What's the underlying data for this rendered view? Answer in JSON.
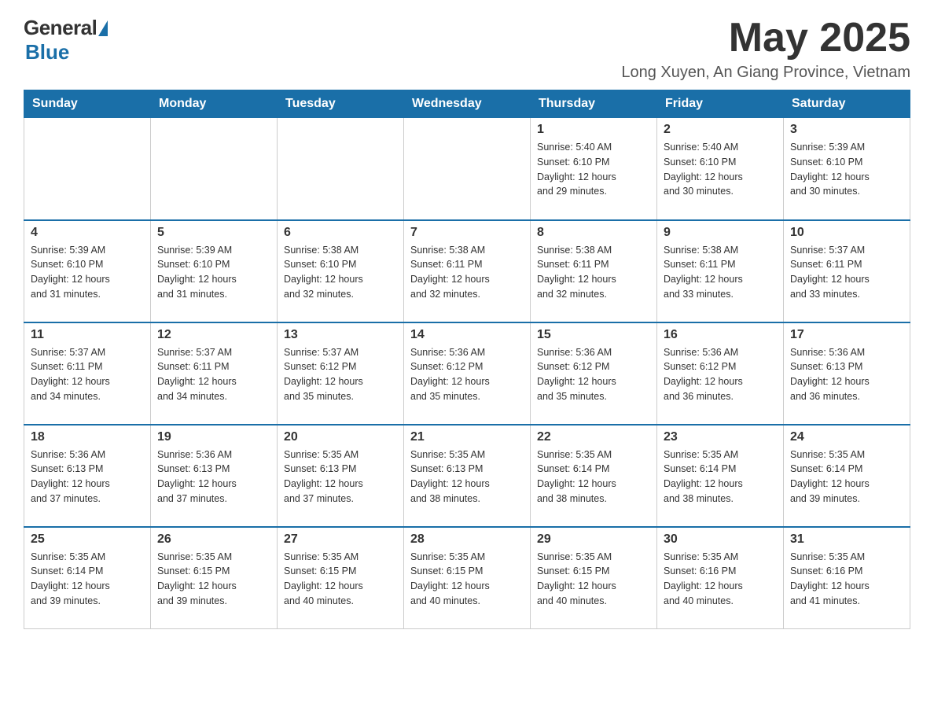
{
  "header": {
    "logo_general": "General",
    "logo_blue": "Blue",
    "month_title": "May 2025",
    "location": "Long Xuyen, An Giang Province, Vietnam"
  },
  "days_of_week": [
    "Sunday",
    "Monday",
    "Tuesday",
    "Wednesday",
    "Thursday",
    "Friday",
    "Saturday"
  ],
  "weeks": [
    [
      {
        "day": "",
        "info": ""
      },
      {
        "day": "",
        "info": ""
      },
      {
        "day": "",
        "info": ""
      },
      {
        "day": "",
        "info": ""
      },
      {
        "day": "1",
        "info": "Sunrise: 5:40 AM\nSunset: 6:10 PM\nDaylight: 12 hours\nand 29 minutes."
      },
      {
        "day": "2",
        "info": "Sunrise: 5:40 AM\nSunset: 6:10 PM\nDaylight: 12 hours\nand 30 minutes."
      },
      {
        "day": "3",
        "info": "Sunrise: 5:39 AM\nSunset: 6:10 PM\nDaylight: 12 hours\nand 30 minutes."
      }
    ],
    [
      {
        "day": "4",
        "info": "Sunrise: 5:39 AM\nSunset: 6:10 PM\nDaylight: 12 hours\nand 31 minutes."
      },
      {
        "day": "5",
        "info": "Sunrise: 5:39 AM\nSunset: 6:10 PM\nDaylight: 12 hours\nand 31 minutes."
      },
      {
        "day": "6",
        "info": "Sunrise: 5:38 AM\nSunset: 6:10 PM\nDaylight: 12 hours\nand 32 minutes."
      },
      {
        "day": "7",
        "info": "Sunrise: 5:38 AM\nSunset: 6:11 PM\nDaylight: 12 hours\nand 32 minutes."
      },
      {
        "day": "8",
        "info": "Sunrise: 5:38 AM\nSunset: 6:11 PM\nDaylight: 12 hours\nand 32 minutes."
      },
      {
        "day": "9",
        "info": "Sunrise: 5:38 AM\nSunset: 6:11 PM\nDaylight: 12 hours\nand 33 minutes."
      },
      {
        "day": "10",
        "info": "Sunrise: 5:37 AM\nSunset: 6:11 PM\nDaylight: 12 hours\nand 33 minutes."
      }
    ],
    [
      {
        "day": "11",
        "info": "Sunrise: 5:37 AM\nSunset: 6:11 PM\nDaylight: 12 hours\nand 34 minutes."
      },
      {
        "day": "12",
        "info": "Sunrise: 5:37 AM\nSunset: 6:11 PM\nDaylight: 12 hours\nand 34 minutes."
      },
      {
        "day": "13",
        "info": "Sunrise: 5:37 AM\nSunset: 6:12 PM\nDaylight: 12 hours\nand 35 minutes."
      },
      {
        "day": "14",
        "info": "Sunrise: 5:36 AM\nSunset: 6:12 PM\nDaylight: 12 hours\nand 35 minutes."
      },
      {
        "day": "15",
        "info": "Sunrise: 5:36 AM\nSunset: 6:12 PM\nDaylight: 12 hours\nand 35 minutes."
      },
      {
        "day": "16",
        "info": "Sunrise: 5:36 AM\nSunset: 6:12 PM\nDaylight: 12 hours\nand 36 minutes."
      },
      {
        "day": "17",
        "info": "Sunrise: 5:36 AM\nSunset: 6:13 PM\nDaylight: 12 hours\nand 36 minutes."
      }
    ],
    [
      {
        "day": "18",
        "info": "Sunrise: 5:36 AM\nSunset: 6:13 PM\nDaylight: 12 hours\nand 37 minutes."
      },
      {
        "day": "19",
        "info": "Sunrise: 5:36 AM\nSunset: 6:13 PM\nDaylight: 12 hours\nand 37 minutes."
      },
      {
        "day": "20",
        "info": "Sunrise: 5:35 AM\nSunset: 6:13 PM\nDaylight: 12 hours\nand 37 minutes."
      },
      {
        "day": "21",
        "info": "Sunrise: 5:35 AM\nSunset: 6:13 PM\nDaylight: 12 hours\nand 38 minutes."
      },
      {
        "day": "22",
        "info": "Sunrise: 5:35 AM\nSunset: 6:14 PM\nDaylight: 12 hours\nand 38 minutes."
      },
      {
        "day": "23",
        "info": "Sunrise: 5:35 AM\nSunset: 6:14 PM\nDaylight: 12 hours\nand 38 minutes."
      },
      {
        "day": "24",
        "info": "Sunrise: 5:35 AM\nSunset: 6:14 PM\nDaylight: 12 hours\nand 39 minutes."
      }
    ],
    [
      {
        "day": "25",
        "info": "Sunrise: 5:35 AM\nSunset: 6:14 PM\nDaylight: 12 hours\nand 39 minutes."
      },
      {
        "day": "26",
        "info": "Sunrise: 5:35 AM\nSunset: 6:15 PM\nDaylight: 12 hours\nand 39 minutes."
      },
      {
        "day": "27",
        "info": "Sunrise: 5:35 AM\nSunset: 6:15 PM\nDaylight: 12 hours\nand 40 minutes."
      },
      {
        "day": "28",
        "info": "Sunrise: 5:35 AM\nSunset: 6:15 PM\nDaylight: 12 hours\nand 40 minutes."
      },
      {
        "day": "29",
        "info": "Sunrise: 5:35 AM\nSunset: 6:15 PM\nDaylight: 12 hours\nand 40 minutes."
      },
      {
        "day": "30",
        "info": "Sunrise: 5:35 AM\nSunset: 6:16 PM\nDaylight: 12 hours\nand 40 minutes."
      },
      {
        "day": "31",
        "info": "Sunrise: 5:35 AM\nSunset: 6:16 PM\nDaylight: 12 hours\nand 41 minutes."
      }
    ]
  ]
}
